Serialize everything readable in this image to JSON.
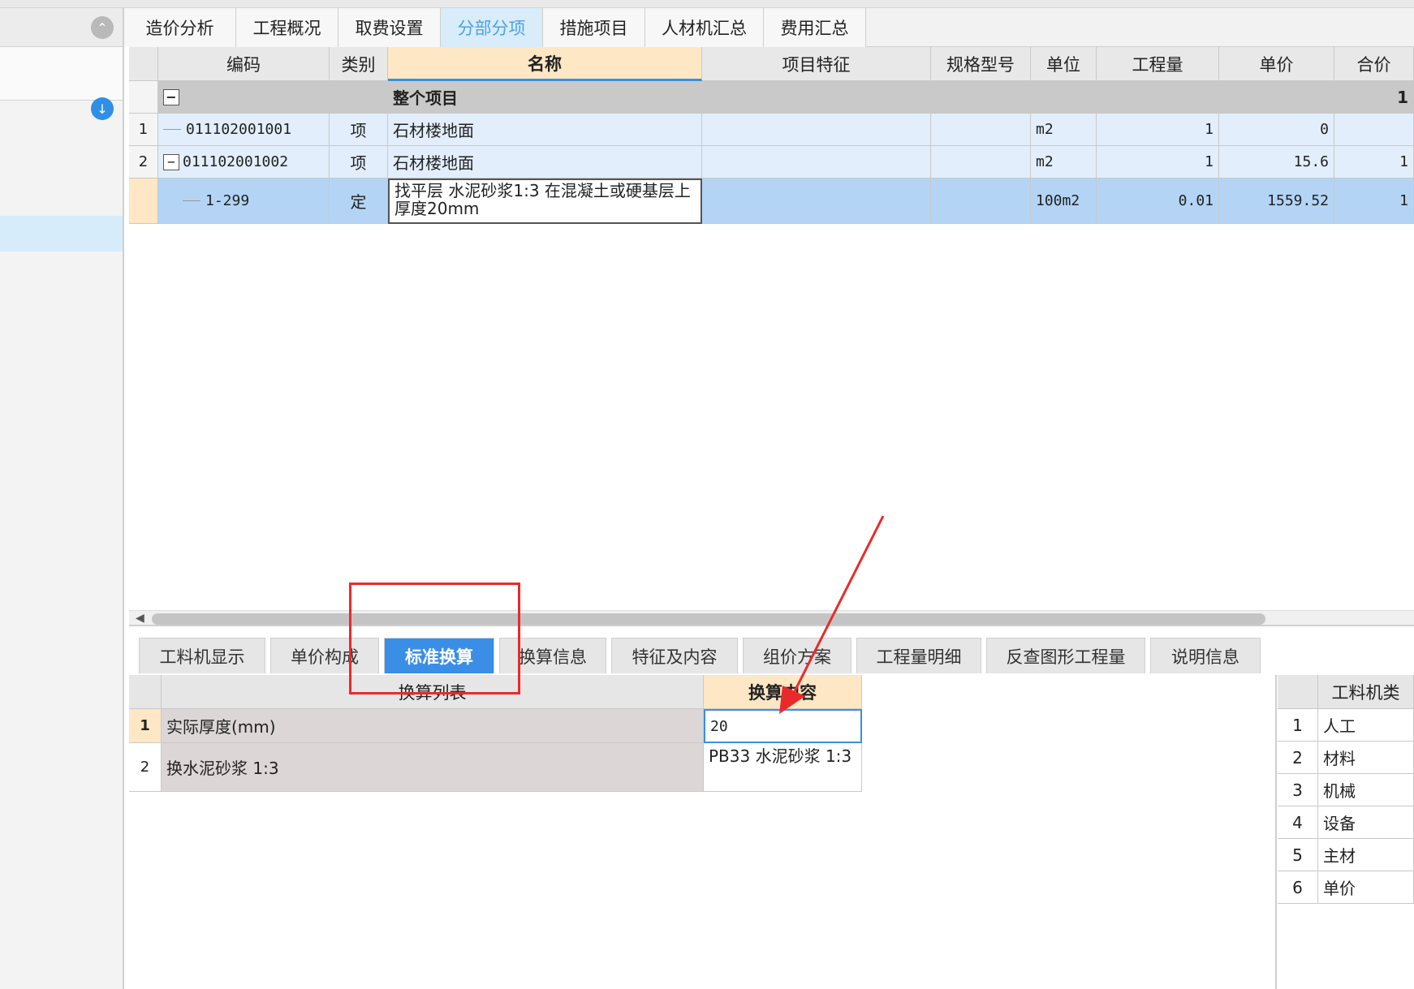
{
  "main_tabs": [
    {
      "label": "造价分析"
    },
    {
      "label": "工程概况"
    },
    {
      "label": "取费设置"
    },
    {
      "label": "分部分项"
    },
    {
      "label": "措施项目"
    },
    {
      "label": "人材机汇总"
    },
    {
      "label": "费用汇总"
    }
  ],
  "grid": {
    "headers": [
      "编码",
      "类别",
      "名称",
      "项目特征",
      "规格型号",
      "单位",
      "工程量",
      "单价",
      "合价"
    ],
    "total_row": {
      "name": "整个项目",
      "total": "1"
    },
    "rows": [
      {
        "num": "1",
        "code": "011102001001",
        "type": "项",
        "name": "石材楼地面",
        "feature": "",
        "spec": "",
        "unit": "m2",
        "qty": "1",
        "price": "0",
        "total": ""
      },
      {
        "num": "2",
        "code": "011102001002",
        "type": "项",
        "name": "石材楼地面",
        "feature": "",
        "spec": "",
        "unit": "m2",
        "qty": "1",
        "price": "15.6",
        "total": "1"
      },
      {
        "num": "",
        "code": "1-299",
        "type": "定",
        "name": "找平层 水泥砂浆1:3 在混凝土或硬基层上厚度20mm",
        "feature": "",
        "spec": "",
        "unit": "100m2",
        "qty": "0.01",
        "price": "1559.52",
        "total": "1"
      }
    ]
  },
  "bottom_tabs": [
    {
      "label": "工料机显示"
    },
    {
      "label": "单价构成"
    },
    {
      "label": "标准换算"
    },
    {
      "label": "换算信息"
    },
    {
      "label": "特征及内容"
    },
    {
      "label": "组价方案"
    },
    {
      "label": "工程量明细"
    },
    {
      "label": "反查图形工程量"
    },
    {
      "label": "说明信息"
    }
  ],
  "conversion": {
    "headers": [
      "换算列表",
      "换算内容"
    ],
    "rows": [
      {
        "num": "1",
        "label": "实际厚度(mm)",
        "value": "20"
      },
      {
        "num": "2",
        "label": "换水泥砂浆 1:3",
        "value": "PB33  水泥砂浆 1:3"
      }
    ]
  },
  "right_panel": {
    "header": "工料机类",
    "rows": [
      {
        "num": "1",
        "label": "人工"
      },
      {
        "num": "2",
        "label": "材料"
      },
      {
        "num": "3",
        "label": "机械"
      },
      {
        "num": "4",
        "label": "设备"
      },
      {
        "num": "5",
        "label": "主材"
      },
      {
        "num": "6",
        "label": "单价"
      }
    ]
  },
  "colors": {
    "accent": "#3a8ee6",
    "annotation": "#ea2a2a",
    "header_highlight": "#fde7c4"
  }
}
